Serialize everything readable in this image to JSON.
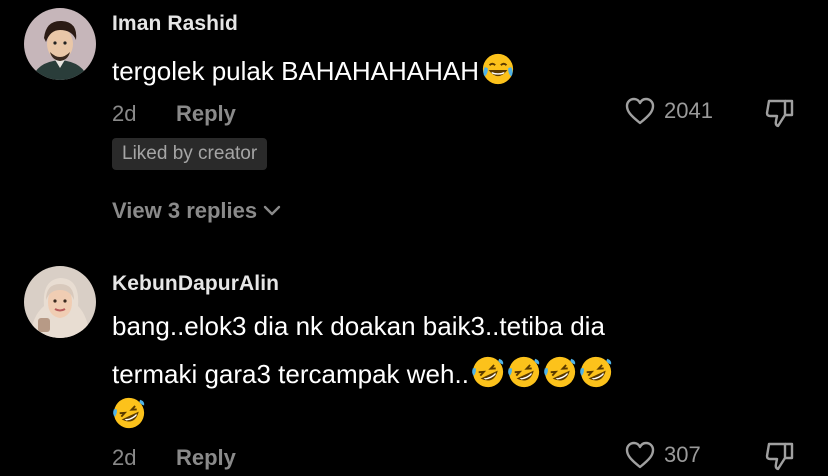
{
  "comments": [
    {
      "username": "Iman Rashid",
      "text": "tergolek pulak BAHAHAHAHAH",
      "emoji": "joy-emoji",
      "age": "2d",
      "reply_label": "Reply",
      "likes": "2041",
      "badge": "Liked by creator",
      "view_replies": "View 3 replies"
    },
    {
      "username": "KebunDapurAlin",
      "text_line1": "bang..elok3 dia nk doakan baik3..tetiba dia",
      "text_line2": "termaki gara3 tercampak weh..",
      "emoji": "rofl-emoji",
      "age": "2d",
      "reply_label": "Reply",
      "likes": "307"
    }
  ],
  "colors": {
    "background": "#000000",
    "text": "#ffffff",
    "muted": "#8a8a8a",
    "badge_bg": "#2a2a2a"
  },
  "icons": [
    "heart-outline-icon",
    "thumbs-down-icon",
    "chevron-down-icon"
  ]
}
